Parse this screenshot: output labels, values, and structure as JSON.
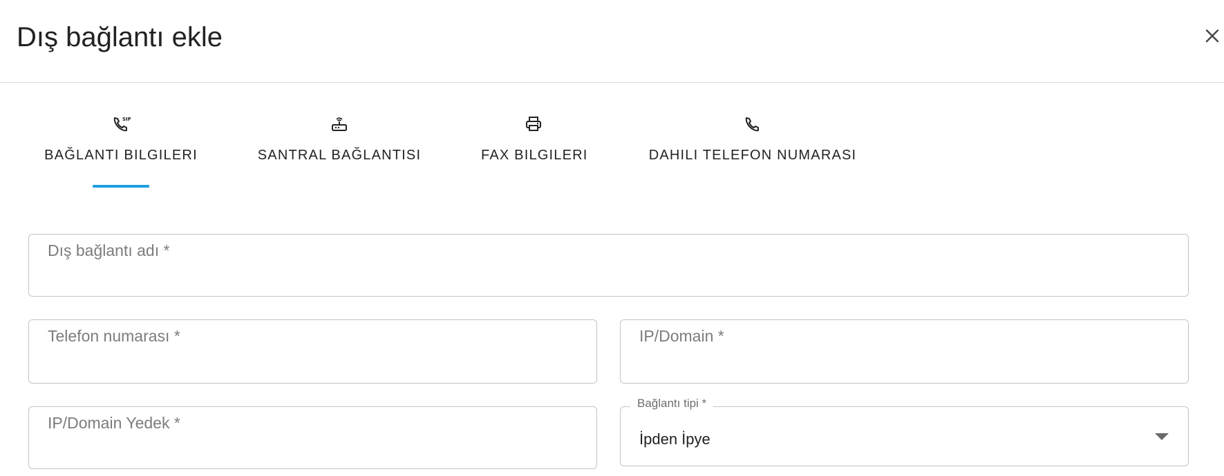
{
  "dialog": {
    "title": "Dış bağlantı ekle",
    "close_icon": "close-icon"
  },
  "tabs": [
    {
      "label": "BAĞLANTI BILGILERI",
      "icon": "sip-phone-icon",
      "active": true
    },
    {
      "label": "SANTRAL BAĞLANTISI",
      "icon": "router-icon",
      "active": false
    },
    {
      "label": "FAX BILGILERI",
      "icon": "printer-icon",
      "active": false
    },
    {
      "label": "DAHILI TELEFON NUMARASI",
      "icon": "phone-icon",
      "active": false
    }
  ],
  "form": {
    "connection_name": {
      "placeholder": "Dış bağlantı adı *",
      "value": ""
    },
    "phone_number": {
      "placeholder": "Telefon numarası *",
      "value": ""
    },
    "ip_domain": {
      "placeholder": "IP/Domain *",
      "value": ""
    },
    "ip_domain_backup": {
      "placeholder": "IP/Domain Yedek *",
      "value": ""
    },
    "connection_type": {
      "label": "Bağlantı tipi *",
      "value": "İpden İpye"
    }
  },
  "colors": {
    "accent": "#1e9fe0",
    "border": "#c4c4c4",
    "placeholder": "#7c7c7c"
  }
}
